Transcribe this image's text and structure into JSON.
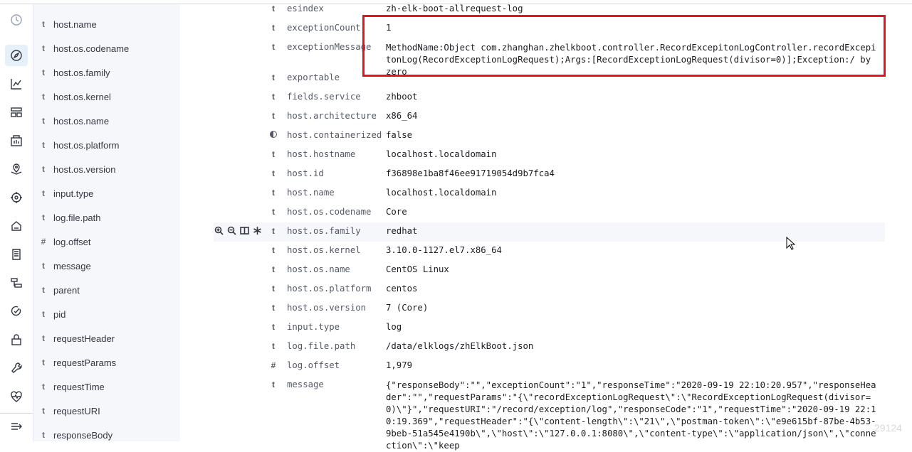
{
  "nav": [
    "clock-icon",
    "compass-icon",
    "visualize-icon",
    "dashboard-icon",
    "canvas-icon",
    "maps-icon",
    "ml-icon",
    "infrastructure-icon",
    "logs-icon",
    "apm-icon",
    "uptime-icon",
    "siem-icon",
    "dev-tools-icon",
    "monitoring-icon",
    "collapse-icon"
  ],
  "fields": [
    {
      "type": "t",
      "name": "host.name"
    },
    {
      "type": "t",
      "name": "host.os.codename"
    },
    {
      "type": "t",
      "name": "host.os.family"
    },
    {
      "type": "t",
      "name": "host.os.kernel"
    },
    {
      "type": "t",
      "name": "host.os.name"
    },
    {
      "type": "t",
      "name": "host.os.platform"
    },
    {
      "type": "t",
      "name": "host.os.version"
    },
    {
      "type": "t",
      "name": "input.type"
    },
    {
      "type": "t",
      "name": "log.file.path"
    },
    {
      "type": "#",
      "name": "log.offset"
    },
    {
      "type": "t",
      "name": "message"
    },
    {
      "type": "t",
      "name": "parent"
    },
    {
      "type": "t",
      "name": "pid"
    },
    {
      "type": "t",
      "name": "requestHeader"
    },
    {
      "type": "t",
      "name": "requestParams"
    },
    {
      "type": "t",
      "name": "requestTime"
    },
    {
      "type": "t",
      "name": "requestURI"
    },
    {
      "type": "t",
      "name": "responseBody"
    }
  ],
  "doc": [
    {
      "type": "t",
      "key": "esindex",
      "value": "zh-elk-boot-allrequest-log"
    },
    {
      "type": "t",
      "key": "exceptionCount",
      "value": "1"
    },
    {
      "type": "t",
      "key": "exceptionMessage",
      "value": "MethodName:Object com.zhanghan.zhelkboot.controller.RecordExcepitonLogController.recordExcepitonLog(RecordExceptionLogRequest);Args:[RecordExceptionLogRequest(divisor=0)];Exception:/ by zero"
    },
    {
      "type": "t",
      "key": "exportable",
      "value": ""
    },
    {
      "type": "t",
      "key": "fields.service",
      "value": "zhboot"
    },
    {
      "type": "t",
      "key": "host.architecture",
      "value": "x86_64"
    },
    {
      "type": "bool",
      "key": "host.containerized",
      "value": "false"
    },
    {
      "type": "t",
      "key": "host.hostname",
      "value": "localhost.localdomain"
    },
    {
      "type": "t",
      "key": "host.id",
      "value": "f36898e1ba8f46ee91719054d9b7fca4"
    },
    {
      "type": "t",
      "key": "host.name",
      "value": "localhost.localdomain"
    },
    {
      "type": "t",
      "key": "host.os.codename",
      "value": "Core"
    },
    {
      "type": "t",
      "key": "host.os.family",
      "value": "redhat"
    },
    {
      "type": "t",
      "key": "host.os.kernel",
      "value": "3.10.0-1127.el7.x86_64"
    },
    {
      "type": "t",
      "key": "host.os.name",
      "value": "CentOS Linux"
    },
    {
      "type": "t",
      "key": "host.os.platform",
      "value": "centos"
    },
    {
      "type": "t",
      "key": "host.os.version",
      "value": "7 (Core)"
    },
    {
      "type": "t",
      "key": "input.type",
      "value": "log"
    },
    {
      "type": "t",
      "key": "log.file.path",
      "value": "/data/elklogs/zhElkBoot.json"
    },
    {
      "type": "#",
      "key": "log.offset",
      "value": "1,979"
    },
    {
      "type": "t",
      "key": "message",
      "value": "{\"responseBody\":\"\",\"exceptionCount\":\"1\",\"responseTime\":\"2020-09-19 22:10:20.957\",\"responseHeader\":\"\",\"requestParams\":\"{\\\"recordExceptionLogRequest\\\":\\\"RecordExceptionLogRequest(divisor=0)\\\"}\",\"requestURI\":\"/record/exception/log\",\"responseCode\":\"1\",\"requestTime\":\"2020-09-19 22:10:19.369\",\"requestHeader\":\"{\\\"content-length\\\":\\\"21\\\",\\\"postman-token\\\":\\\"e9e615bf-87be-4b53-9beb-51a545e4190b\\\",\\\"host\\\":\\\"127.0.0.1:8080\\\",\\\"content-type\\\":\\\"application/json\\\",\\\"connection\\\":\\\"keep"
    }
  ],
  "watermark": "29124"
}
